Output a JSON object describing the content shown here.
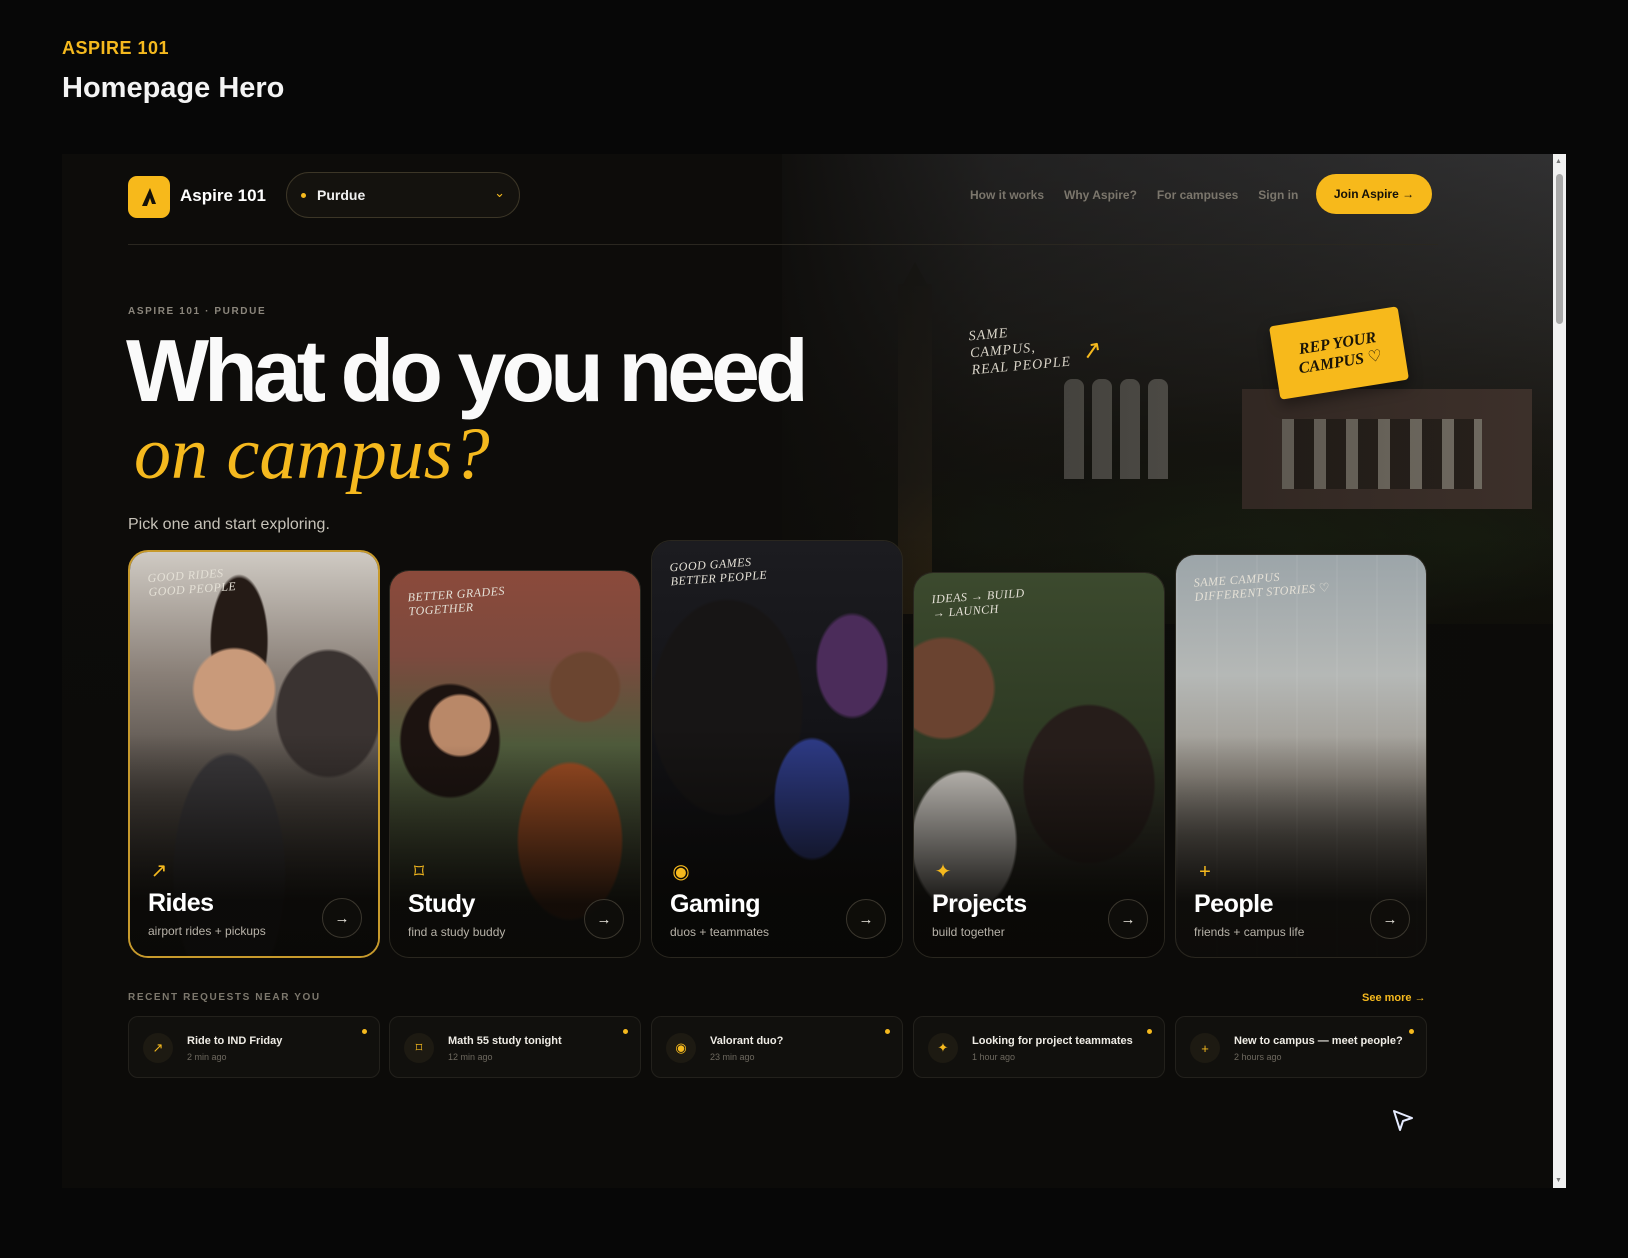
{
  "deck": {
    "tag": "ASPIRE 101",
    "title": "Homepage Hero"
  },
  "nav": {
    "brand": "Aspire 101",
    "campus": "Purdue",
    "links": [
      "How it works",
      "Why Aspire?",
      "For campuses",
      "Sign in"
    ],
    "cta": "Join Aspire →"
  },
  "hero": {
    "eyebrow": "ASPIRE 101 · PURDUE",
    "headline": "What do you need",
    "headline_accent": "on campus?",
    "subtext": "Pick one and start exploring.",
    "handnote": "SAME\nCAMPUS,\nREAL PEOPLE",
    "sticker": "REP YOUR\nCAMPUS ♡"
  },
  "cards": [
    {
      "title": "Rides",
      "subtitle": "airport rides + pickups",
      "note": "GOOD RIDES\nGOOD PEOPLE",
      "icon": "arrow-up-right-icon",
      "glyph": "↗"
    },
    {
      "title": "Study",
      "subtitle": "find a study buddy",
      "note": "BETTER GRADES\nTOGETHER",
      "icon": "book-icon",
      "glyph": "⌑"
    },
    {
      "title": "Gaming",
      "subtitle": "duos + teammates",
      "note": "GOOD GAMES\nBETTER PEOPLE",
      "icon": "target-icon",
      "glyph": "◉"
    },
    {
      "title": "Projects",
      "subtitle": "build together",
      "note": "IDEAS → BUILD\n→ LAUNCH",
      "icon": "sparkle-icon",
      "glyph": "✦"
    },
    {
      "title": "People",
      "subtitle": "friends + campus life",
      "note": "SAME CAMPUS\nDIFFERENT STORIES ♡",
      "icon": "plus-icon",
      "glyph": "+"
    }
  ],
  "recent": {
    "label": "RECENT REQUESTS NEAR YOU",
    "see_more": "See more →",
    "items": [
      {
        "title": "Ride to IND Friday",
        "time": "2 min ago",
        "glyph": "↗"
      },
      {
        "title": "Math 55 study tonight",
        "time": "12 min ago",
        "glyph": "⌑"
      },
      {
        "title": "Valorant duo?",
        "time": "23 min ago",
        "glyph": "◉"
      },
      {
        "title": "Looking for project teammates",
        "time": "1 hour ago",
        "glyph": "✦"
      },
      {
        "title": "New to campus — meet people?",
        "time": "2 hours ago",
        "glyph": "+"
      }
    ]
  },
  "colors": {
    "accent": "#f7b91b",
    "background": "#0c0b09"
  }
}
